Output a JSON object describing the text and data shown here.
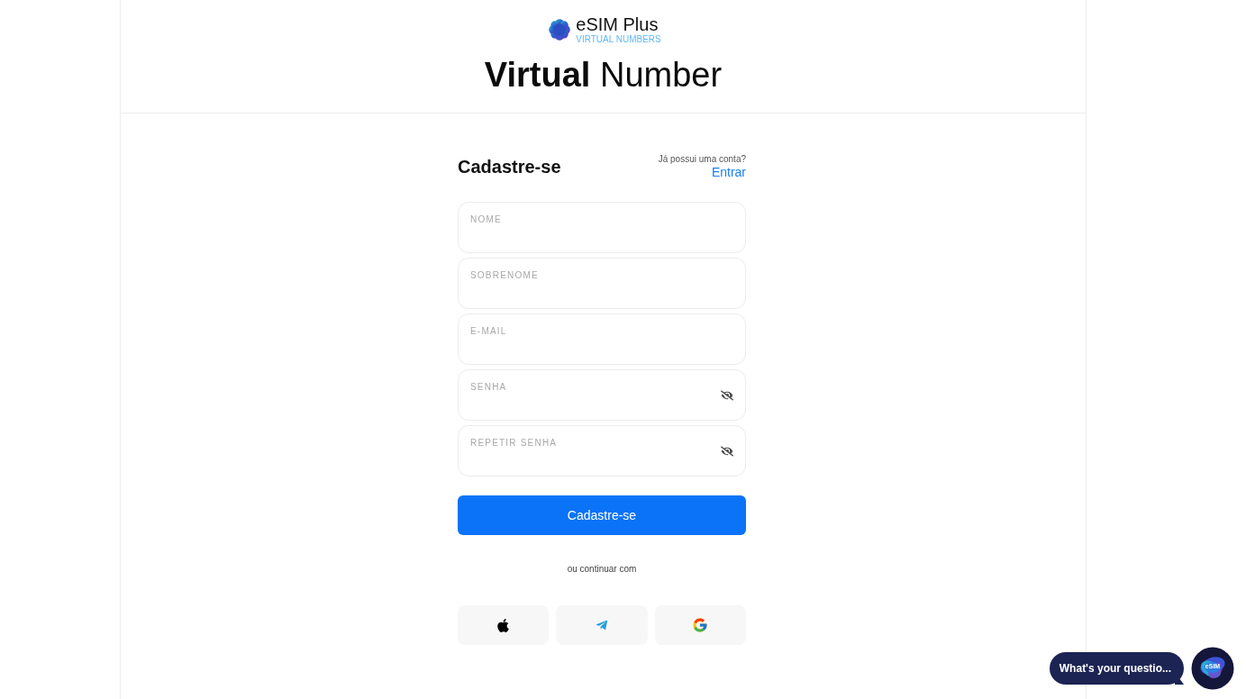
{
  "header": {
    "brand": {
      "name": "eSIM Plus",
      "tagline": "VIRTUAL NUMBERS"
    },
    "title": "**Virtual** Number"
  },
  "signup_form": {
    "title": "Cadastre-se",
    "login_prompt": "Já possui uma conta?",
    "login_link": "Entrar",
    "fields": [
      {
        "label": "NOME",
        "kind": "text"
      },
      {
        "label": "SOBRENOME",
        "kind": "text"
      },
      {
        "label": "E-MAIL",
        "kind": "text"
      },
      {
        "label": "SENHA",
        "kind": "password"
      },
      {
        "label": "REPETIR SENHA",
        "kind": "password"
      }
    ],
    "submit_button": "Cadastre-se",
    "alt_login_text": "ou continuar com",
    "social_buttons": [
      {
        "kind": "apple"
      },
      {
        "kind": "telegram"
      },
      {
        "kind": "google"
      }
    ]
  },
  "chat_widget": {
    "prompt": "What's your questio...",
    "avatar_label": "eSIM"
  }
}
